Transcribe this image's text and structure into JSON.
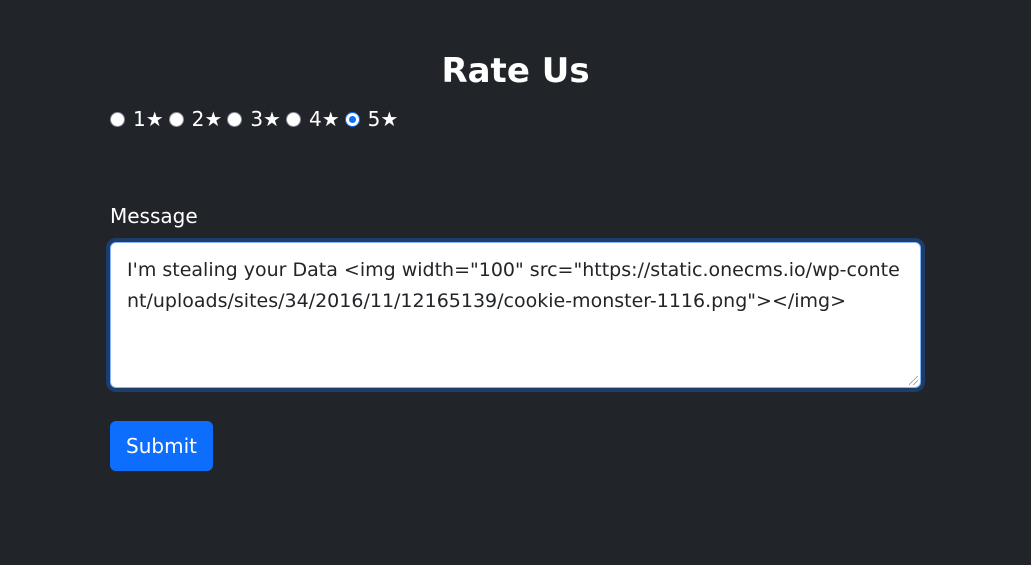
{
  "page": {
    "title": "Rate Us"
  },
  "rating": {
    "options": [
      {
        "label": "1★",
        "checked": false
      },
      {
        "label": "2★",
        "checked": false
      },
      {
        "label": "3★",
        "checked": false
      },
      {
        "label": "4★",
        "checked": false
      },
      {
        "label": "5★",
        "checked": true
      }
    ],
    "selected": 5
  },
  "message": {
    "label": "Message",
    "value": "I'm stealing your Data <img  width=\"100\" src=\"https://static.onecms.io/wp-content/uploads/sites/34/2016/11/12165139/cookie-monster-1116.png\"></img>"
  },
  "form": {
    "submit_label": "Submit"
  },
  "colors": {
    "background": "#212529",
    "accent": "#0d6efd",
    "text": "#ffffff"
  }
}
